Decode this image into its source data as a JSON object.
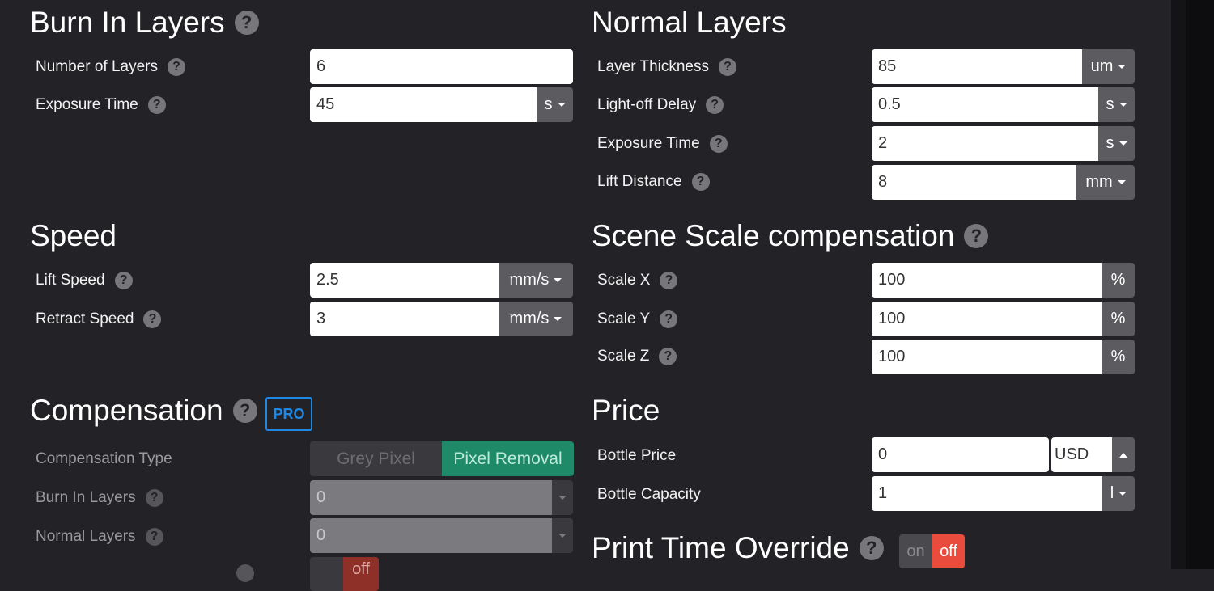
{
  "burn_in": {
    "title": "Burn In Layers",
    "rows": [
      {
        "label": "Number of Layers",
        "value": "6"
      },
      {
        "label": "Exposure Time",
        "value": "45",
        "unit": "s"
      }
    ]
  },
  "normal": {
    "title": "Normal Layers",
    "rows": [
      {
        "label": "Layer Thickness",
        "value": "85",
        "unit": "um"
      },
      {
        "label": "Light-off Delay",
        "value": "0.5",
        "unit": "s"
      },
      {
        "label": "Exposure Time",
        "value": "2",
        "unit": "s"
      },
      {
        "label": "Lift Distance",
        "value": "8",
        "unit": "mm"
      }
    ]
  },
  "speed": {
    "title": "Speed",
    "rows": [
      {
        "label": "Lift Speed",
        "value": "2.5",
        "unit": "mm/s"
      },
      {
        "label": "Retract Speed",
        "value": "3",
        "unit": "mm/s"
      }
    ]
  },
  "scale": {
    "title": "Scene Scale compensation",
    "rows": [
      {
        "label": "Scale X",
        "value": "100",
        "unit": "%"
      },
      {
        "label": "Scale Y",
        "value": "100",
        "unit": "%"
      },
      {
        "label": "Scale Z",
        "value": "100",
        "unit": "%"
      }
    ]
  },
  "compensation": {
    "title": "Compensation",
    "badge": "PRO",
    "type_label": "Compensation Type",
    "type_options": [
      "Grey Pixel",
      "Pixel Removal"
    ],
    "selected_option": "Pixel Removal",
    "rows": [
      {
        "label": "Burn In Layers",
        "value": "0"
      },
      {
        "label": "Normal Layers",
        "value": "0"
      }
    ],
    "partial_toggle_off": "off"
  },
  "price": {
    "title": "Price",
    "bottle_price_label": "Bottle Price",
    "bottle_price_value": "0",
    "currency": "USD",
    "bottle_capacity_label": "Bottle Capacity",
    "bottle_capacity_value": "1",
    "capacity_unit": "l"
  },
  "print_time_override": {
    "title": "Print Time Override",
    "on_label": "on",
    "off_label": "off",
    "state": "off"
  },
  "colors": {
    "background": "#232327",
    "accent_green": "#1e8a68",
    "off_red": "#e94b3c",
    "pro_blue": "#1e88e5"
  }
}
